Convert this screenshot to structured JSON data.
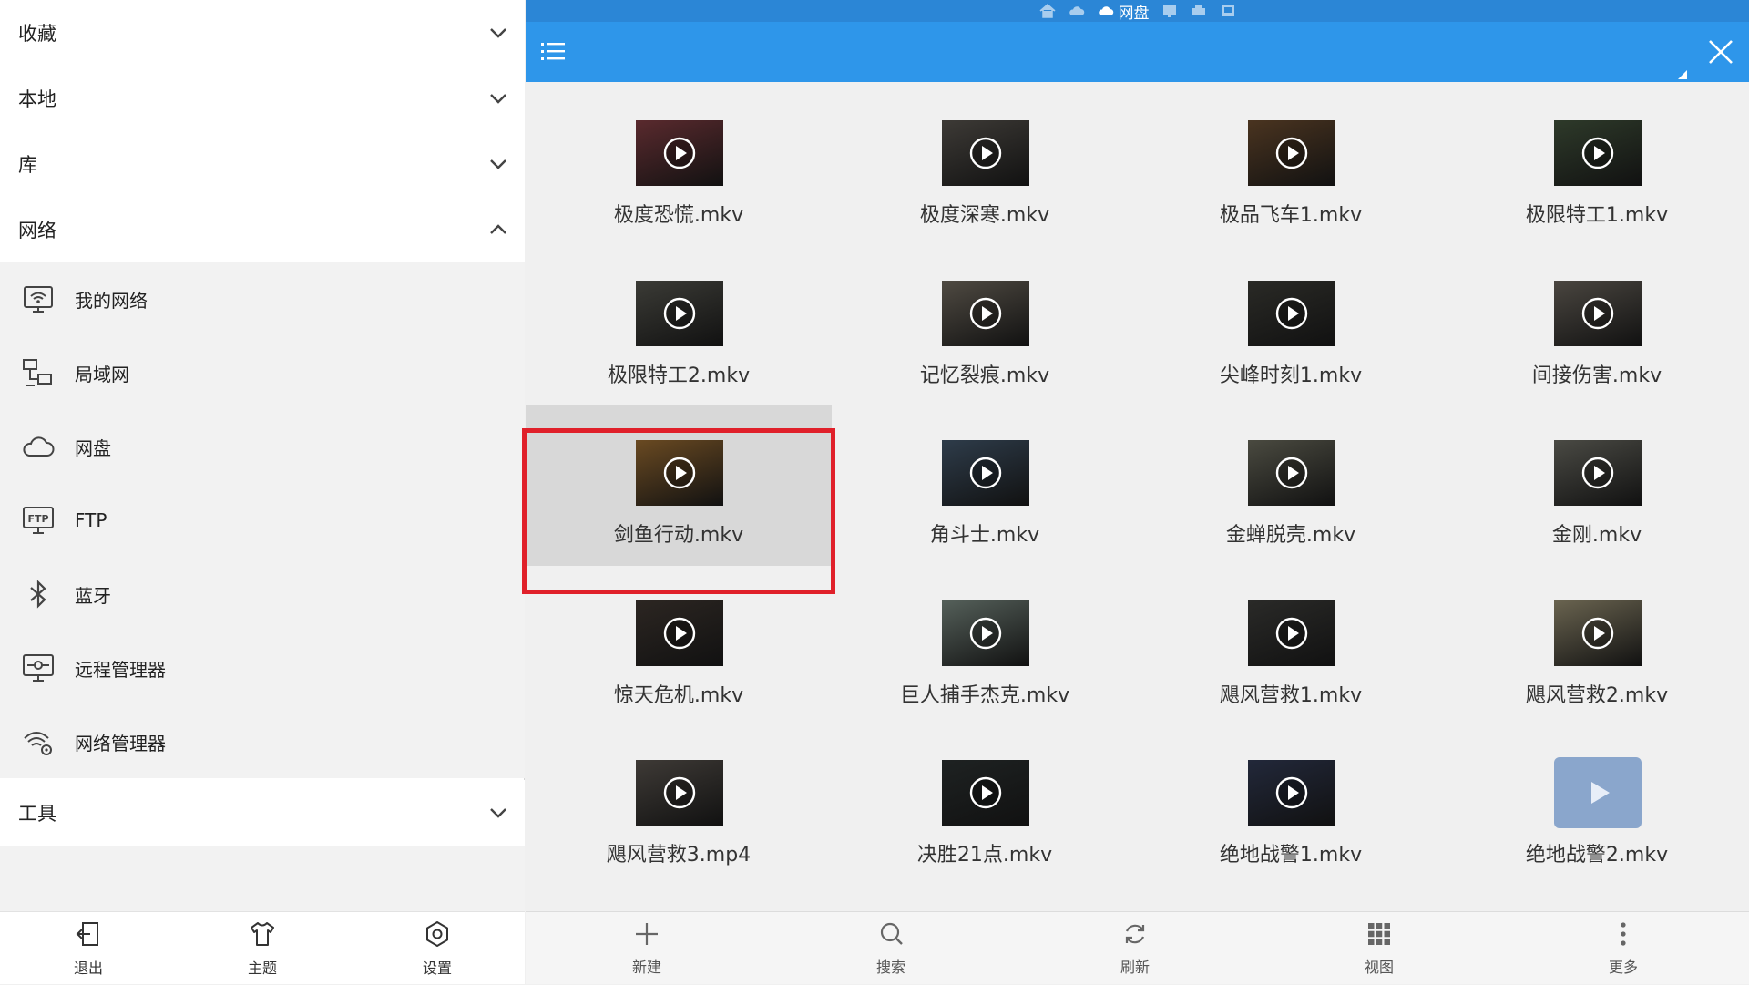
{
  "sidebar": {
    "sections": {
      "favorites": "收藏",
      "local": "本地",
      "library": "库",
      "network": "网络",
      "tools": "工具"
    },
    "network_items": [
      {
        "label": "我的网络",
        "icon": "wifi-monitor-icon"
      },
      {
        "label": "局域网",
        "icon": "lan-icon"
      },
      {
        "label": "网盘",
        "icon": "cloud-icon"
      },
      {
        "label": "FTP",
        "icon": "ftp-icon"
      },
      {
        "label": "蓝牙",
        "icon": "bluetooth-icon"
      },
      {
        "label": "远程管理器",
        "icon": "remote-manager-icon"
      },
      {
        "label": "网络管理器",
        "icon": "network-manager-icon"
      }
    ],
    "toolbar": {
      "exit": "退出",
      "theme": "主题",
      "settings": "设置"
    }
  },
  "breadcrumb": {
    "active": "网盘"
  },
  "files": [
    {
      "name": "极度恐慌.mkv",
      "thumb": "#5a2a2e"
    },
    {
      "name": "极度深寒.mkv",
      "thumb": "#3d3a36"
    },
    {
      "name": "极品飞车1.mkv",
      "thumb": "#4a3420"
    },
    {
      "name": "极限特工1.mkv",
      "thumb": "#2e3a2a"
    },
    {
      "name": "极限特工2.mkv",
      "thumb": "#3b3b36"
    },
    {
      "name": "记忆裂痕.mkv",
      "thumb": "#4f4a42"
    },
    {
      "name": "尖峰时刻1.mkv",
      "thumb": "#2a2a26"
    },
    {
      "name": "间接伤害.mkv",
      "thumb": "#4a4640"
    },
    {
      "name": "剑鱼行动.mkv",
      "thumb": "#6a4a22"
    },
    {
      "name": "角斗士.mkv",
      "thumb": "#2e3c4a"
    },
    {
      "name": "金蝉脱壳.mkv",
      "thumb": "#4a4a40"
    },
    {
      "name": "金刚.mkv",
      "thumb": "#4a4a44"
    },
    {
      "name": "惊天危机.mkv",
      "thumb": "#2c2622"
    },
    {
      "name": "巨人捕手杰克.mkv",
      "thumb": "#55605a"
    },
    {
      "name": "飓风营救1.mkv",
      "thumb": "#2a2a28"
    },
    {
      "name": "飓风营救2.mkv",
      "thumb": "#6a6450"
    },
    {
      "name": "飓风营救3.mp4",
      "thumb": "#3e3a36"
    },
    {
      "name": "决胜21点.mkv",
      "thumb": "#1e2222"
    },
    {
      "name": "绝地战警1.mkv",
      "thumb": "#22283a"
    },
    {
      "name": "绝地战警2.mkv",
      "thumb": "#8aa6cc"
    }
  ],
  "selected_file": "剑鱼行动.mkv",
  "main_toolbar": {
    "new": "新建",
    "search": "搜索",
    "refresh": "刷新",
    "view": "视图",
    "more": "更多"
  },
  "colors": {
    "header": "#2e96ea",
    "topbar": "#2b86d6",
    "selection_border": "#e0202a"
  }
}
